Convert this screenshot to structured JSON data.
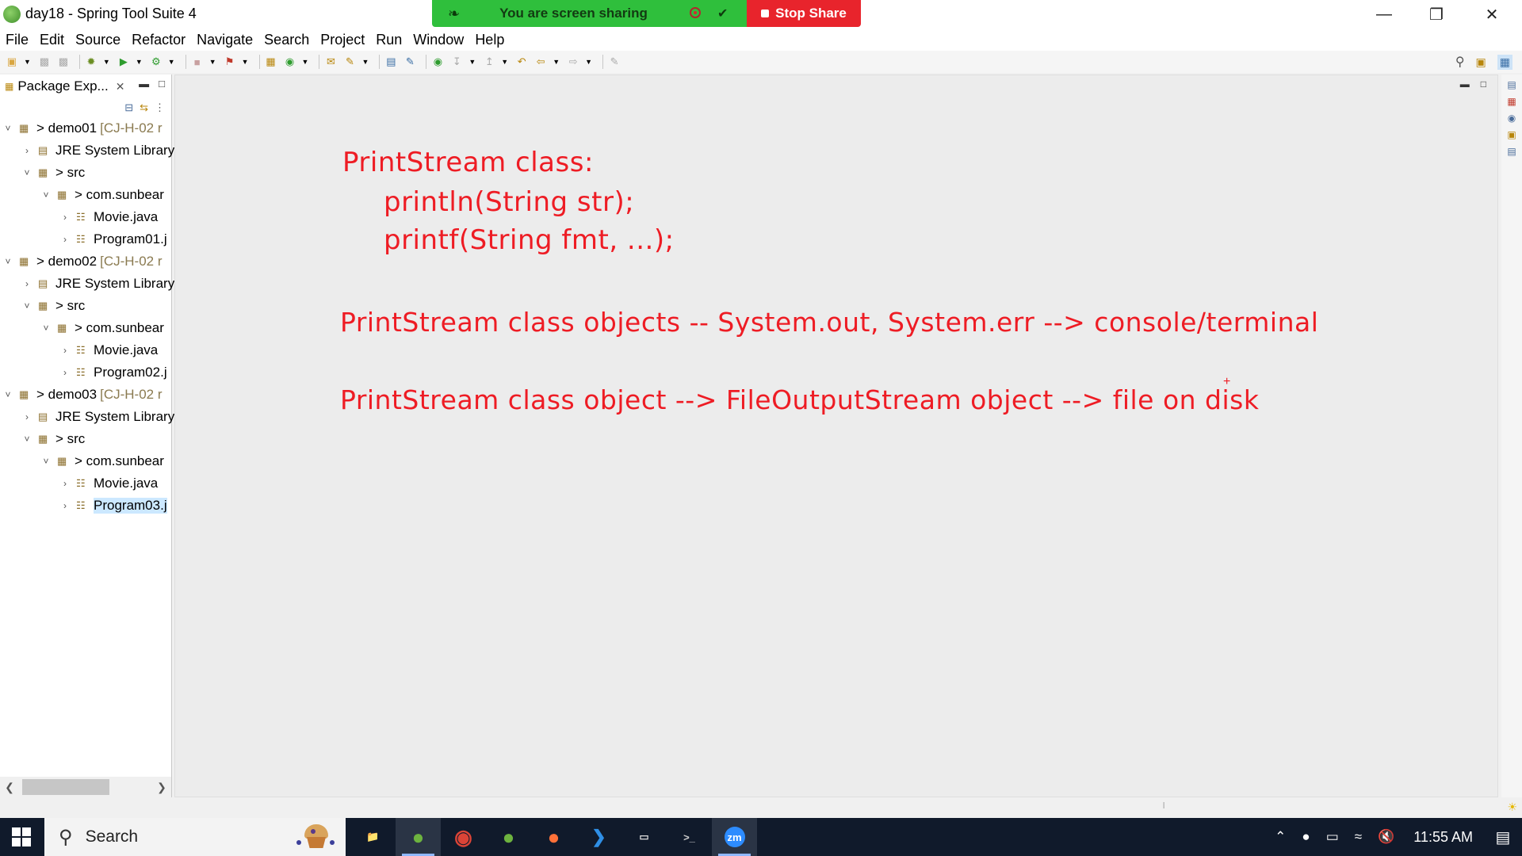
{
  "window": {
    "title": "day18 - Spring Tool Suite 4",
    "minimize_glyph": "—",
    "restore_glyph": "❐",
    "close_glyph": "✕"
  },
  "share_bar": {
    "status_text": "You are screen sharing",
    "stop_label": "Stop Share",
    "accent_color": "#2fbf3c",
    "stop_color": "#e8242c"
  },
  "menu": {
    "items": [
      "File",
      "Edit",
      "Source",
      "Refactor",
      "Navigate",
      "Search",
      "Project",
      "Run",
      "Window",
      "Help"
    ]
  },
  "package_explorer": {
    "tab_label": "Package Exp...",
    "close_glyph": "✕",
    "tree": [
      {
        "label": "> demo01",
        "decoration": "[CJ-H-02 r",
        "icon": "project-icon",
        "chevron": "˅"
      },
      {
        "label": "JRE System Library",
        "decoration": "",
        "icon": "library-icon",
        "chevron": "›"
      },
      {
        "label": "> src",
        "decoration": "",
        "icon": "source-folder-icon",
        "chevron": "˅"
      },
      {
        "label": "> com.sunbear",
        "decoration": "",
        "icon": "package-icon",
        "chevron": "˅"
      },
      {
        "label": "Movie.java",
        "decoration": "",
        "icon": "java-file-icon",
        "chevron": "›"
      },
      {
        "label": "Program01.j",
        "decoration": "",
        "icon": "java-file-icon",
        "chevron": "›"
      },
      {
        "label": "> demo02",
        "decoration": "[CJ-H-02 r",
        "icon": "project-icon",
        "chevron": "˅"
      },
      {
        "label": "JRE System Library",
        "decoration": "",
        "icon": "library-icon",
        "chevron": "›"
      },
      {
        "label": "> src",
        "decoration": "",
        "icon": "source-folder-icon",
        "chevron": "˅"
      },
      {
        "label": "> com.sunbear",
        "decoration": "",
        "icon": "package-icon",
        "chevron": "˅"
      },
      {
        "label": "Movie.java",
        "decoration": "",
        "icon": "java-file-icon",
        "chevron": "›"
      },
      {
        "label": "Program02.j",
        "decoration": "",
        "icon": "java-file-icon",
        "chevron": "›"
      },
      {
        "label": "> demo03",
        "decoration": "[CJ-H-02 r",
        "icon": "project-icon",
        "chevron": "˅"
      },
      {
        "label": "JRE System Library",
        "decoration": "",
        "icon": "library-icon",
        "chevron": "›"
      },
      {
        "label": "> src",
        "decoration": "",
        "icon": "source-folder-icon",
        "chevron": "˅"
      },
      {
        "label": "> com.sunbear",
        "decoration": "",
        "icon": "package-icon",
        "chevron": "˅"
      },
      {
        "label": "Movie.java",
        "decoration": "",
        "icon": "java-file-icon",
        "chevron": "›"
      },
      {
        "label": "Program03.j",
        "decoration": "",
        "icon": "java-file-icon",
        "chevron": "›",
        "selected": true
      }
    ]
  },
  "editor_notes": {
    "line1": "PrintStream class:",
    "line2": "println(String str);",
    "line3": "printf(String fmt, ...);",
    "line4": "PrintStream class objects -- System.out, System.err --> console/terminal",
    "line5": "PrintStream class object --> FileOutputStream object --> file on disk",
    "ink_color": "#ee1c24"
  },
  "taskbar": {
    "search_placeholder": "Search",
    "clock": "11:55 AM",
    "apps": [
      {
        "name": "file-explorer-icon",
        "glyph": "📁",
        "color": "#f3c44b"
      },
      {
        "name": "spring-tool-suite-icon",
        "glyph": "●",
        "color": "#6db33f",
        "active": true
      },
      {
        "name": "chrome-icon",
        "glyph": "◉",
        "color": "#db4437"
      },
      {
        "name": "spring-icon",
        "glyph": "●",
        "color": "#6db33f"
      },
      {
        "name": "firefox-icon",
        "glyph": "●",
        "color": "#ff7139"
      },
      {
        "name": "vscode-icon",
        "glyph": "❯",
        "color": "#2f8fe6"
      },
      {
        "name": "screen-icon",
        "glyph": "▭",
        "color": "#dcdcdc"
      },
      {
        "name": "terminal-icon",
        "glyph": ">_",
        "color": "#cccccc"
      },
      {
        "name": "zoom-icon",
        "glyph": "zm",
        "color": "#2d8cff",
        "active": true
      }
    ]
  }
}
